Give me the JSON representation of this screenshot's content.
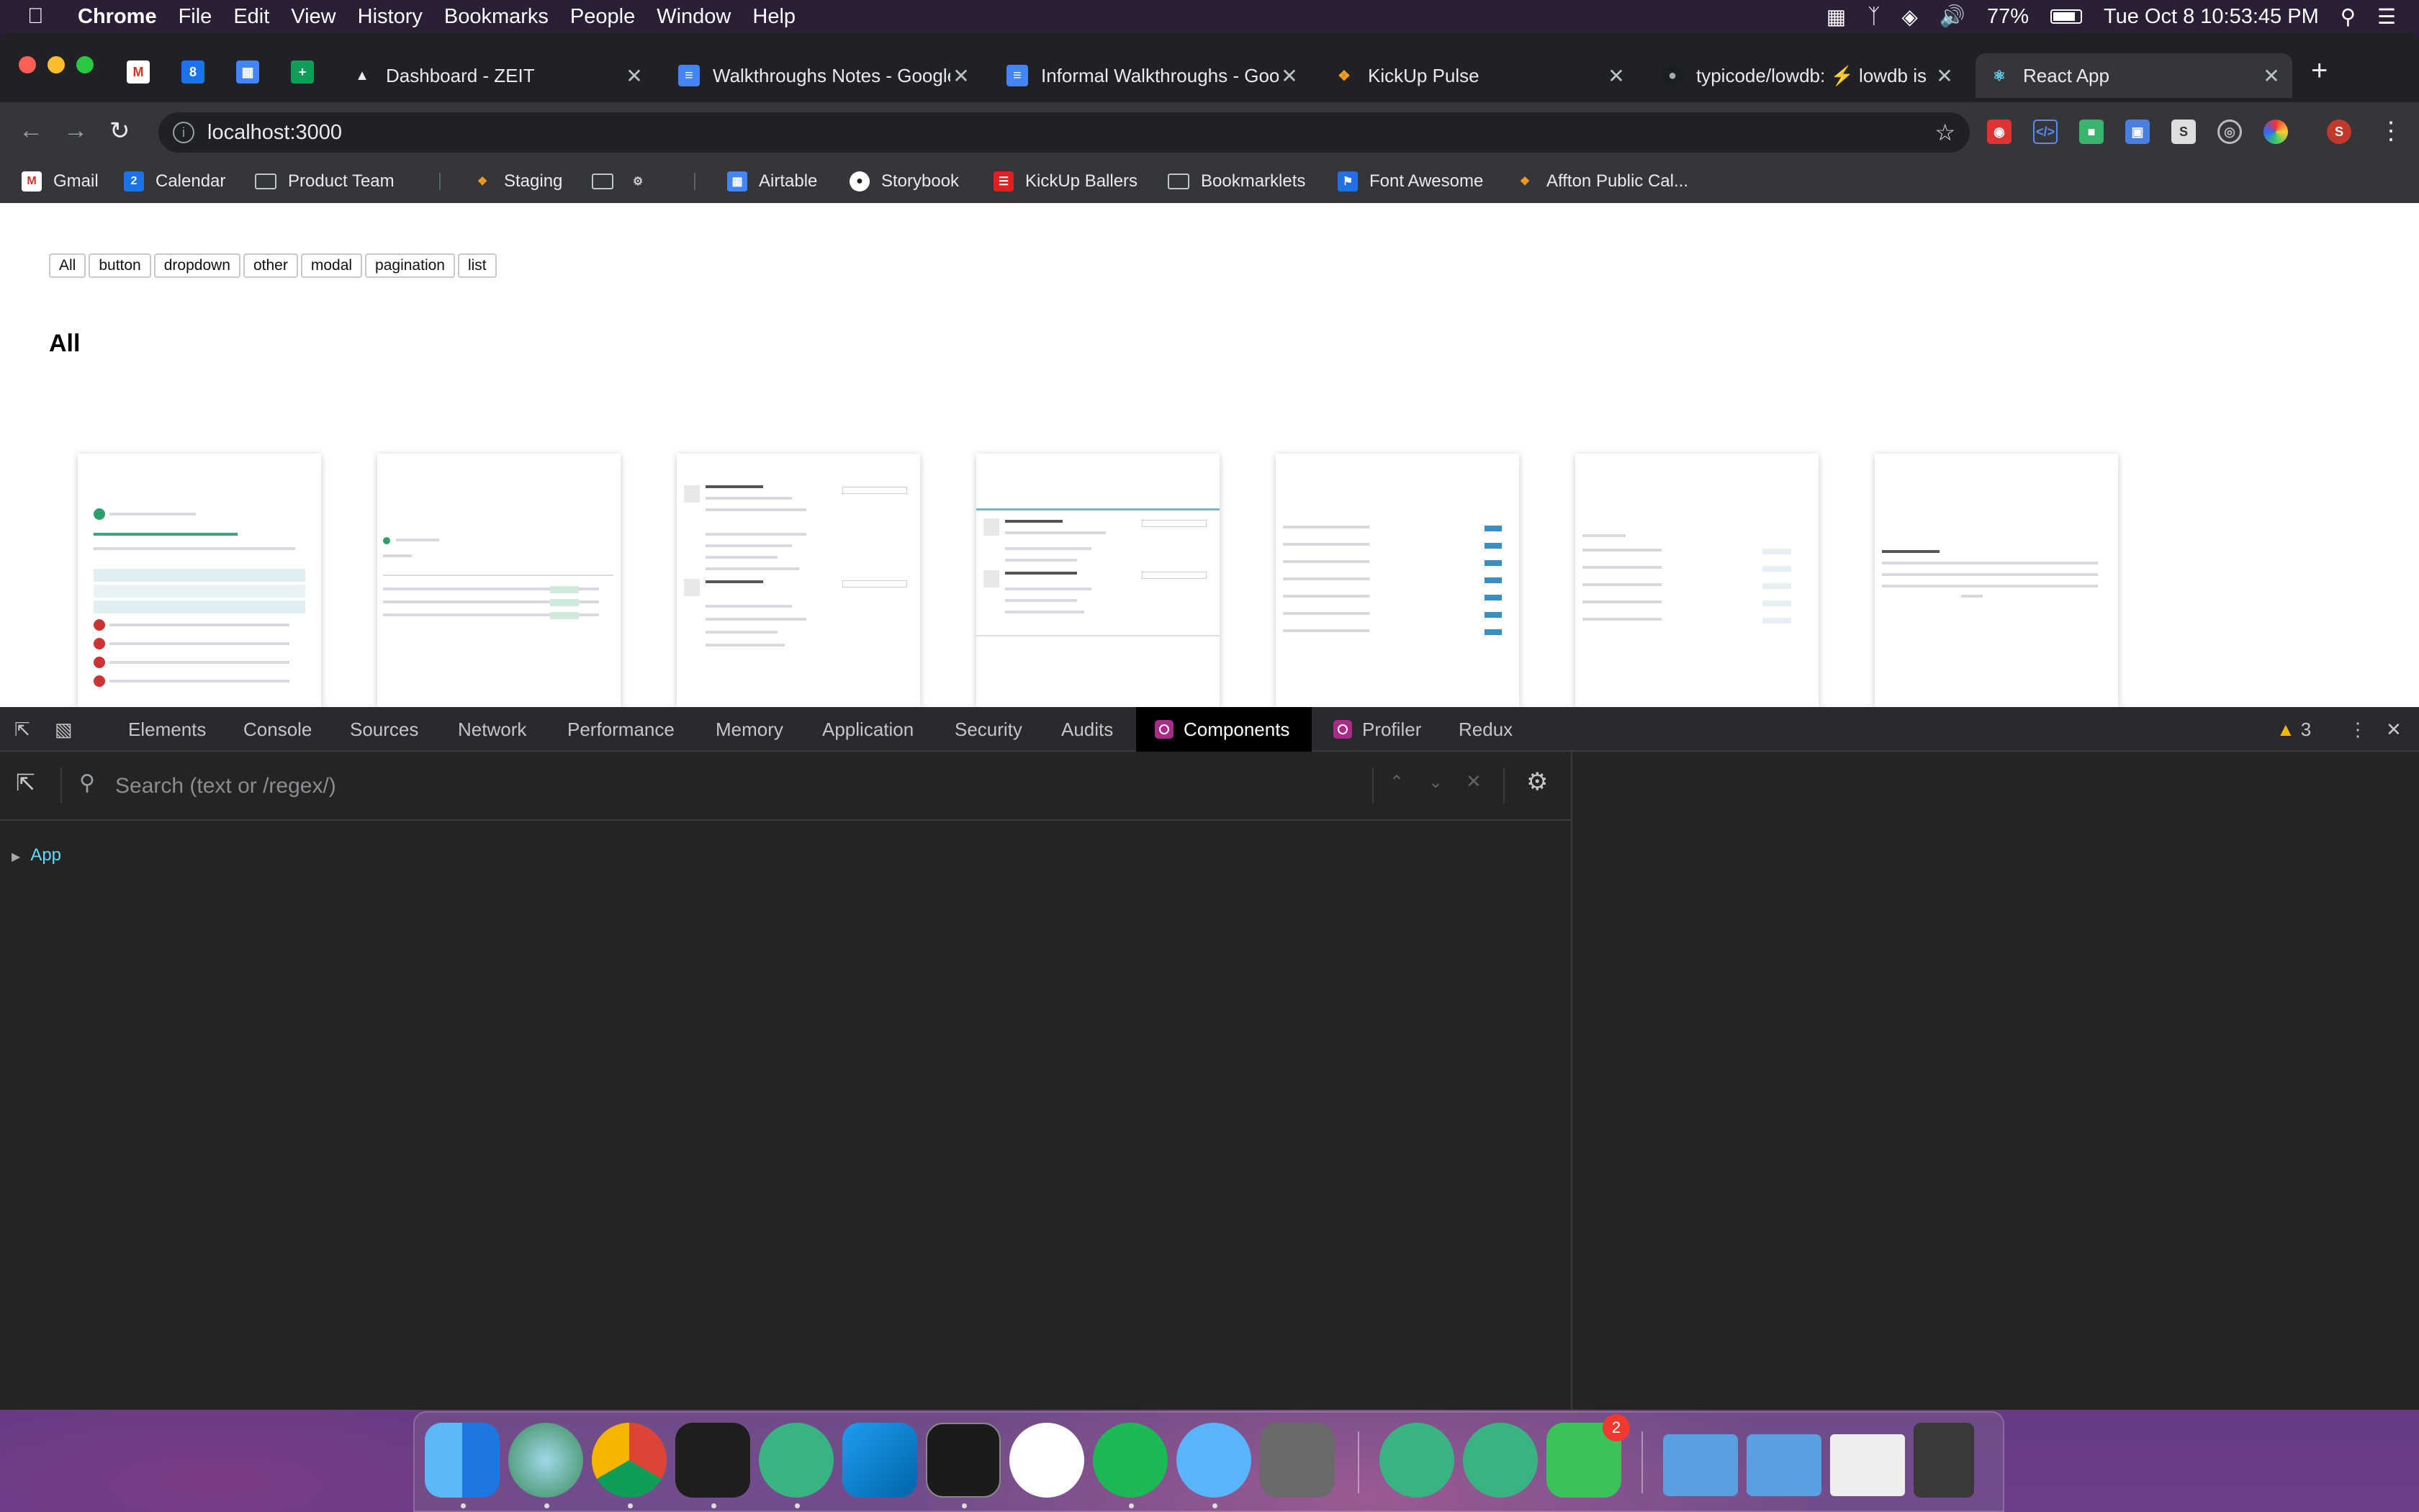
{
  "menubar": {
    "app_name": "Chrome",
    "items": [
      "File",
      "Edit",
      "View",
      "History",
      "Bookmarks",
      "People",
      "Window",
      "Help"
    ],
    "battery": "77%",
    "clock": "Tue Oct 8  10:53:45 PM"
  },
  "tabs": [
    {
      "title": "Dashboard - ZEIT",
      "icon": "zeit-triangle-icon"
    },
    {
      "title": "Walkthroughs Notes - Google",
      "icon": "google-docs-icon"
    },
    {
      "title": "Informal Walkthroughs - Google",
      "icon": "google-docs-icon"
    },
    {
      "title": "KickUp Pulse",
      "icon": "kickup-runner-icon"
    },
    {
      "title": "typicode/lowdb: ⚡ lowdb is",
      "icon": "github-icon"
    },
    {
      "title": "React App",
      "icon": "react-icon"
    }
  ],
  "address": {
    "url": "localhost:3000"
  },
  "bookmarks": [
    {
      "label": "Gmail",
      "icon": "gmail-icon"
    },
    {
      "label": "Calendar",
      "icon": "calendar-icon"
    },
    {
      "label": "Product Team",
      "icon": "folder-icon"
    },
    {
      "label": "Staging",
      "icon": "kickup-runner-icon"
    },
    {
      "label": "",
      "icon": "folder-icon"
    },
    {
      "label": "",
      "icon": "gear-icon"
    },
    {
      "label": "Airtable",
      "icon": "airtable-icon"
    },
    {
      "label": "Storybook",
      "icon": "storybook-icon"
    },
    {
      "label": "KickUp Ballers",
      "icon": "kickup-ballers-icon"
    },
    {
      "label": "Bookmarklets",
      "icon": "folder-icon"
    },
    {
      "label": "Font Awesome",
      "icon": "font-awesome-flag-icon"
    },
    {
      "label": "Affton Public Cal...",
      "icon": "kickup-runner-icon"
    }
  ],
  "page": {
    "filters": [
      "All",
      "button",
      "dropdown",
      "other",
      "modal",
      "pagination",
      "list"
    ],
    "heading": "All"
  },
  "devtools": {
    "tabs": [
      "Elements",
      "Console",
      "Sources",
      "Network",
      "Performance",
      "Memory",
      "Application",
      "Security",
      "Audits",
      "Components",
      "Profiler",
      "Redux"
    ],
    "active_tab": "Components",
    "warnings": "3",
    "search_placeholder": "Search (text or /regex/)",
    "tree_root": "App"
  },
  "dock": {
    "apps": [
      "Finder",
      "Preview",
      "Google Chrome",
      "Figma",
      "Atom",
      "Visual Studio Code",
      "Terminal",
      "Slack",
      "Spotify",
      "Messages",
      "System Preferences",
      "Atom",
      "Atom",
      "FaceTime",
      "Applications",
      "Downloads",
      "Screenshot",
      "Trash"
    ],
    "facetime_badge": "2"
  },
  "colors": {
    "accent_react": "#61dafb",
    "devtools_bg": "#242424",
    "chrome_dark": "#202124"
  }
}
